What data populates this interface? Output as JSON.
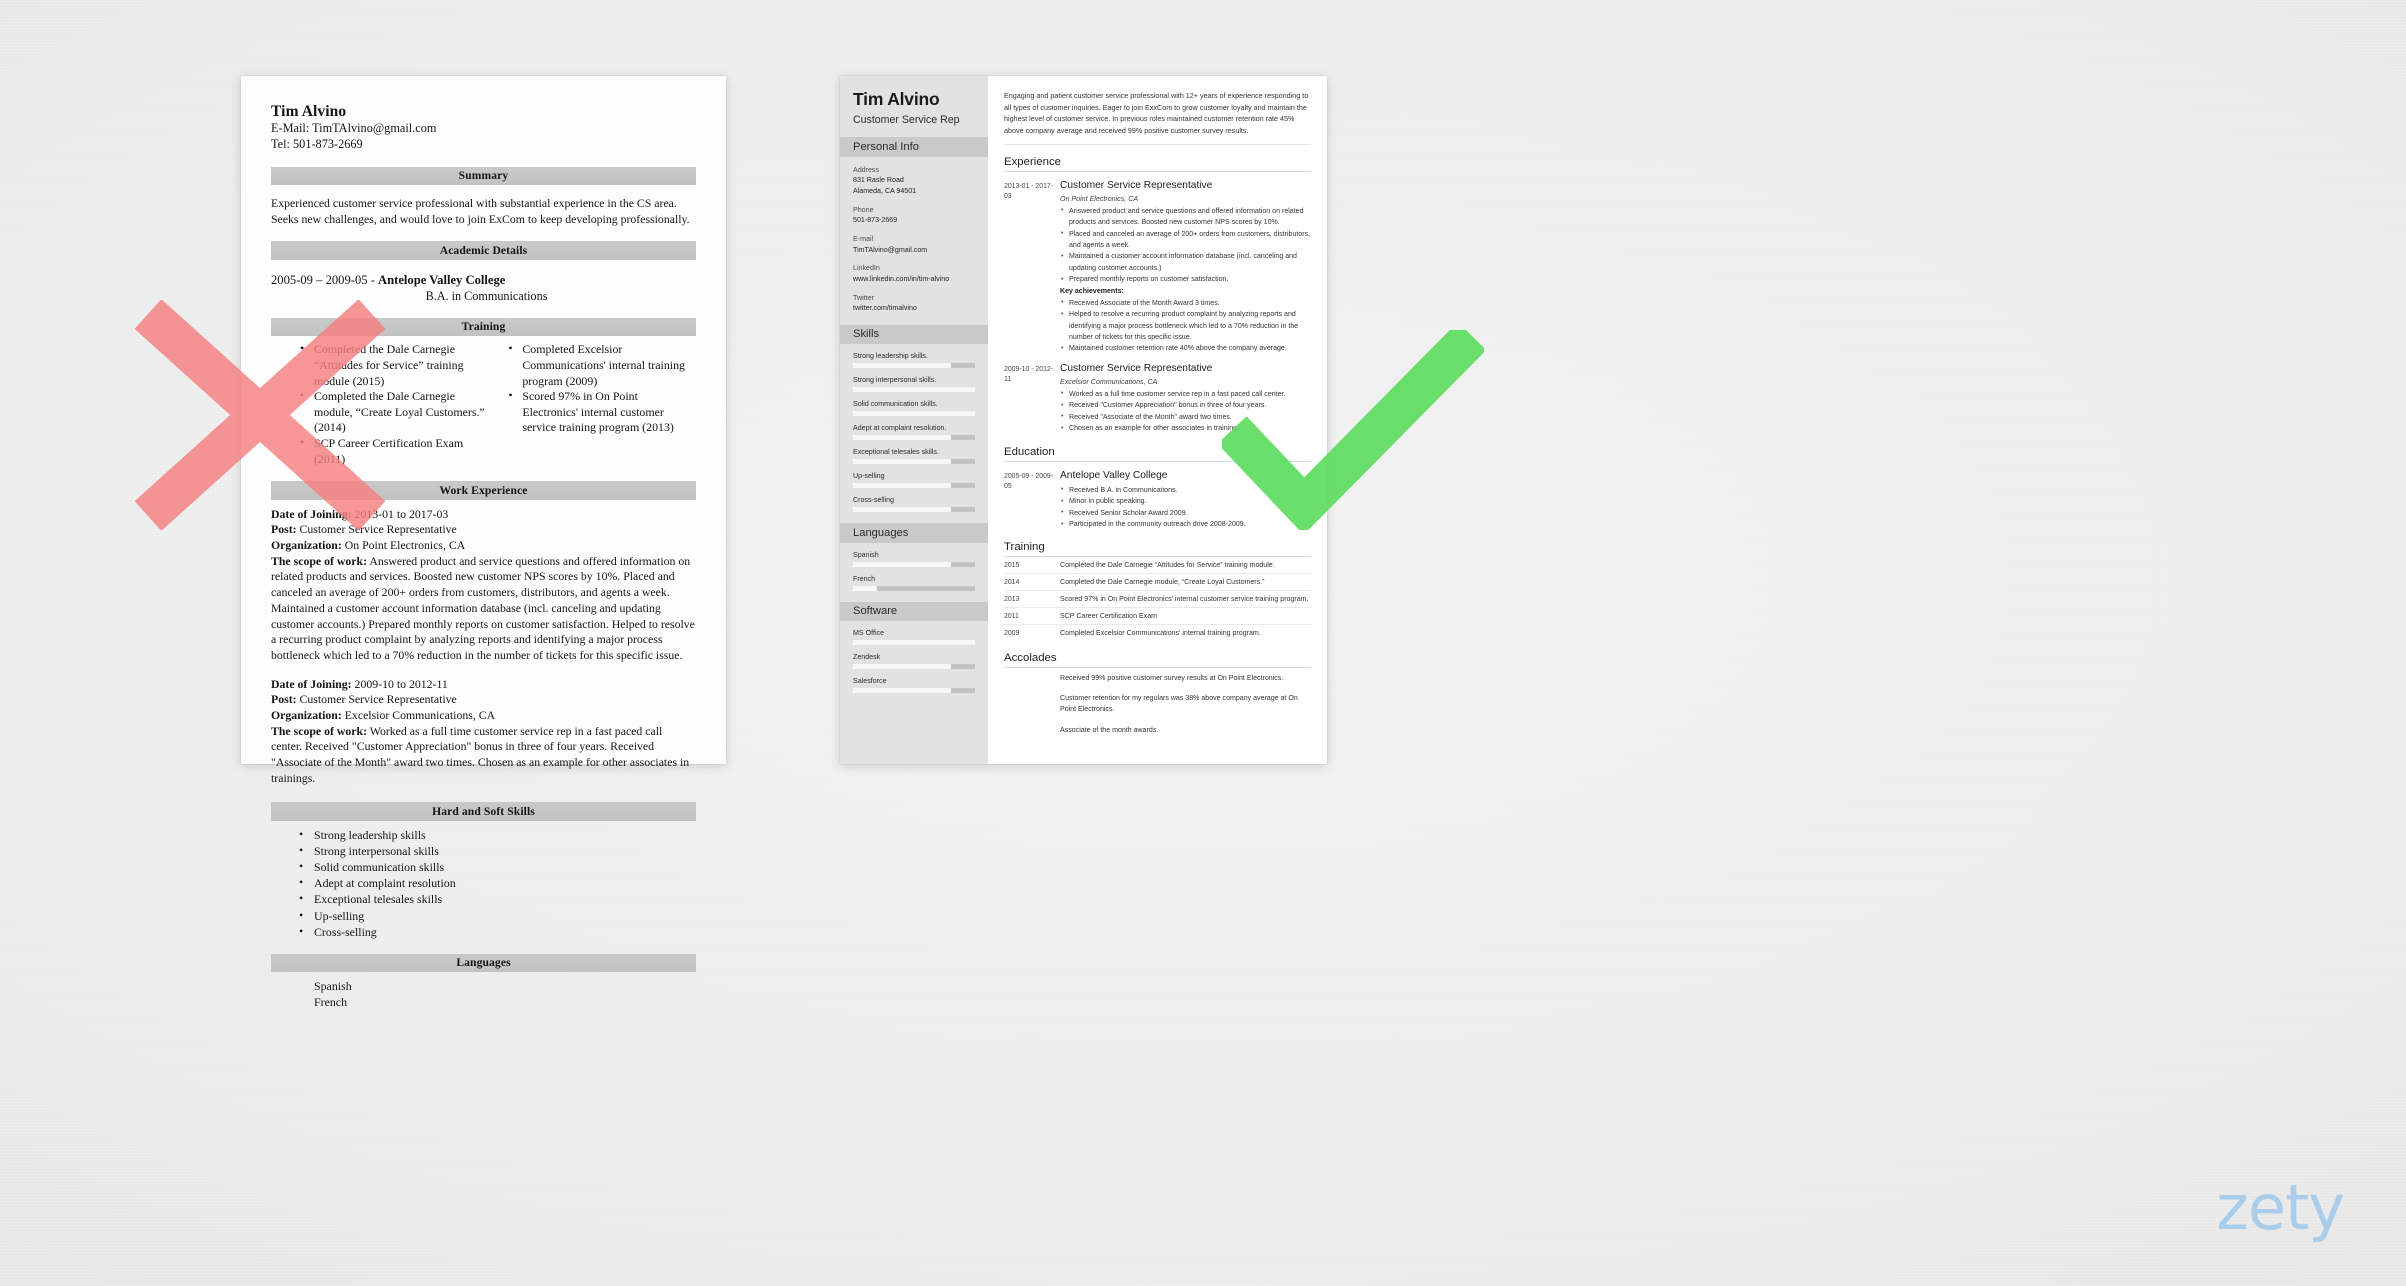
{
  "background": {
    "base_color": "#ececec"
  },
  "branding": {
    "logo_text": "zety",
    "logo_color": "#a9cdea"
  },
  "marks": {
    "bad_mark": {
      "name": "red-x",
      "color": "#F58080"
    },
    "good_mark": {
      "name": "green-check",
      "color": "#5EDC5E"
    }
  },
  "bad_resume": {
    "name": "Tim Alvino",
    "email_line": "E-Mail: TimTAlvino@gmail.com",
    "phone_line": "Tel: 501-873-2669",
    "sections": {
      "summary_head": "Summary",
      "summary_text": "Experienced customer service professional with substantial experience in the CS area. Seeks new challenges, and would love to join ExCom to keep developing professionally.",
      "academic_head": "Academic Details",
      "academic_dates": "2005-09 – 2009-05 - ",
      "academic_school": "Antelope Valley College",
      "academic_degree": "B.A. in Communications",
      "training_head": "Training",
      "training_col_a": [
        "Completed the Dale Carnegie “Attitudes for Service” training module (2015)",
        "Completed the Dale Carnegie module, “Create Loyal Customers.” (2014)",
        "SCP Career Certification Exam (2011)"
      ],
      "training_col_b": [
        "Completed Excelsior Communications' internal training program (2009)",
        "Scored 97% in On Point Electronics' internal customer service training program (2013)"
      ],
      "work_head": "Work Experience",
      "jobs": [
        {
          "date_label": "Date of Joining:",
          "date_value": " 2013-01 to 2017-03",
          "post_label": "Post:",
          "post_value": " Customer Service Representative",
          "org_label": "Organization:",
          "org_value": " On Point Electronics, CA",
          "scope_label": "The scope of work:",
          "scope_value": " Answered product and service questions and offered information on related products and services. Boosted new customer NPS scores by 10%. Placed and canceled an average of 200+ orders from customers, distributors, and agents a week. Maintained a customer account information database (incl. canceling and updating customer accounts.) Prepared monthly reports on customer satisfaction. Helped to resolve a recurring product complaint by analyzing reports and identifying a major process bottleneck which led to a 70% reduction in the number of tickets for this specific issue."
        },
        {
          "date_label": "Date of Joining:",
          "date_value": " 2009-10 to 2012-11",
          "post_label": "Post:",
          "post_value": " Customer Service Representative",
          "org_label": "Organization:",
          "org_value": " Excelsior Communications, CA",
          "scope_label": "The scope of work:",
          "scope_value": " Worked as a full time customer service rep in a fast paced call center. Received \"Customer Appreciation\" bonus in three of four years. Received \"Associate of the Month\" award two times. Chosen as an example for other associates in trainings."
        }
      ],
      "skills_head": "Hard and Soft Skills",
      "skills": [
        "Strong leadership skills",
        "Strong interpersonal skills",
        "Solid communication skills",
        "Adept at complaint resolution",
        "Exceptional telesales skills",
        "Up-selling",
        "Cross-selling"
      ],
      "languages_head": "Languages",
      "languages": [
        "Spanish",
        "French"
      ]
    }
  },
  "good_resume": {
    "sidebar": {
      "name": "Tim Alvino",
      "role": "Customer Service Rep",
      "personal_info_head": "Personal Info",
      "personal_info": [
        {
          "label": "Address",
          "values": [
            "831 Rasle Road",
            "Alameda, CA 94501"
          ]
        },
        {
          "label": "Phone",
          "values": [
            "501-873-2669"
          ]
        },
        {
          "label": "E-mail",
          "values": [
            "TimTAlvino@gmail.com"
          ]
        },
        {
          "label": "LinkedIn",
          "values": [
            "www.linkedin.com/in/tim-alvino"
          ]
        },
        {
          "label": "Twitter",
          "values": [
            "twitter.com/timalvino"
          ]
        }
      ],
      "skills_head": "Skills",
      "skills": [
        {
          "name": "Strong leadership skills.",
          "level": 80
        },
        {
          "name": "Strong interpersonal skills.",
          "level": 100
        },
        {
          "name": "Solid communication skills.",
          "level": 100
        },
        {
          "name": "Adept at complaint resolution.",
          "level": 80
        },
        {
          "name": "Exceptional telesales skills.",
          "level": 80
        },
        {
          "name": "Up-selling",
          "level": 80
        },
        {
          "name": "Cross-selling",
          "level": 80
        }
      ],
      "languages_head": "Languages",
      "languages": [
        {
          "name": "Spanish",
          "level": 80
        },
        {
          "name": "French",
          "level": 20
        }
      ],
      "software_head": "Software",
      "software": [
        {
          "name": "MS Office",
          "level": 100
        },
        {
          "name": "Zendesk",
          "level": 80
        },
        {
          "name": "Salesforce",
          "level": 80
        }
      ]
    },
    "main": {
      "summary": "Engaging and patient customer service professional with 12+ years of experience responding to all types of customer inquiries. Eager to join ExxCom to grow customer loyalty and maintain the highest level of customer service. In previous roles maintained customer retention rate 45% above company average and received 99% positive customer survey results.",
      "experience_head": "Experience",
      "experience": [
        {
          "dates": "2013-01 - 2017-03",
          "title": "Customer Service Representative",
          "org": "On Point Electronics, CA",
          "bullets": [
            "Answered product and service questions and offered information on related products and services. Boosted new customer NPS scores by 10%.",
            "Placed and canceled an average of 200+ orders from customers, distributors, and agents a week.",
            "Maintained a customer account information database (incl. canceling and updating customer accounts.)",
            "Prepared monthly reports on customer satisfaction."
          ],
          "sublabel": "Key achievements:",
          "achievements": [
            "Received Associate of the Month Award 3 times.",
            "Helped to resolve a recurring product complaint by analyzing reports and identifying a major process bottleneck which led to a 70% reduction in the number of tickets for this specific issue.",
            "Maintained customer retention rate 40% above the company average."
          ]
        },
        {
          "dates": "2009-10 - 2012-11",
          "title": "Customer Service Representative",
          "org": "Excelsior Communications, CA",
          "bullets": [
            "Worked as a full time customer service rep in a fast paced call center.",
            "Received \"Customer Appreciation\" bonus in three of four years.",
            "Received \"Associate of the Month\" award two times.",
            "Chosen as an example for other associates in trainings."
          ],
          "sublabel": "",
          "achievements": []
        }
      ],
      "education_head": "Education",
      "education": [
        {
          "dates": "2005-09 - 2009-05",
          "title": "Antelope Valley College",
          "bullets": [
            "Received B.A. in Communications.",
            "Minor in public speaking.",
            "Received Senior Scholar Award 2009.",
            "Participated in the community outreach drive 2008-2009."
          ]
        }
      ],
      "training_head": "Training",
      "training": [
        {
          "year": "2015",
          "text": "Completed the Dale Carnegie “Attitudes for Service” training module."
        },
        {
          "year": "2014",
          "text": "Completed the Dale Carnegie module, “Create Loyal Customers.”"
        },
        {
          "year": "2013",
          "text": "Scored 97% in On Point Electronics' internal customer service training program."
        },
        {
          "year": "2011",
          "text": "SCP Career Certification Exam"
        },
        {
          "year": "2009",
          "text": "Completed Excelsior Communications' internal training program."
        }
      ],
      "accolades_head": "Accolades",
      "accolades": [
        "Received 99% positive customer survey results at On Point Electronics.",
        "Customer retention for my regulars was 38% above company average at On Point Electronics.",
        "Associate of the month awards."
      ]
    }
  }
}
